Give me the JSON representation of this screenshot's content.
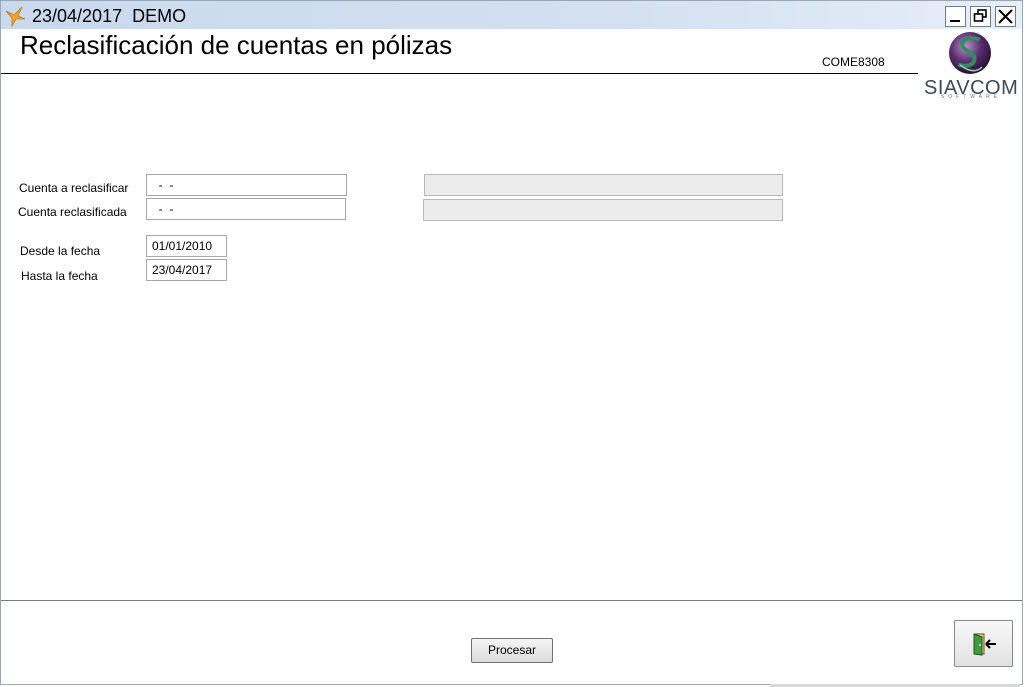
{
  "window": {
    "title": "23/04/2017  DEMO",
    "minimize_icon": "minimize-icon",
    "restore_icon": "restore-icon",
    "close_icon": "close-icon"
  },
  "header": {
    "title": "Reclasificación de cuentas en pólizas",
    "form_code": "COME8308",
    "logo_text": "SIAVCOM",
    "logo_subtext": "SOFTWARE"
  },
  "form": {
    "cuenta_reclasificar": {
      "label": "Cuenta a reclasificar",
      "value": "  -  -",
      "description": ""
    },
    "cuenta_reclasificada": {
      "label": "Cuenta reclasificada",
      "value": "  -  -",
      "description": ""
    },
    "desde_fecha": {
      "label": "Desde la fecha",
      "value": "01/01/2010"
    },
    "hasta_fecha": {
      "label": "Hasta la fecha",
      "value": "23/04/2017"
    }
  },
  "footer": {
    "procesar_label": "Procesar",
    "exit_icon": "exit-door-icon"
  },
  "colors": {
    "titlebar": "#c9d9ee",
    "disabled_field": "#ececec",
    "logo_green": "#2e8f5e",
    "logo_purple": "#5b2d6e"
  }
}
